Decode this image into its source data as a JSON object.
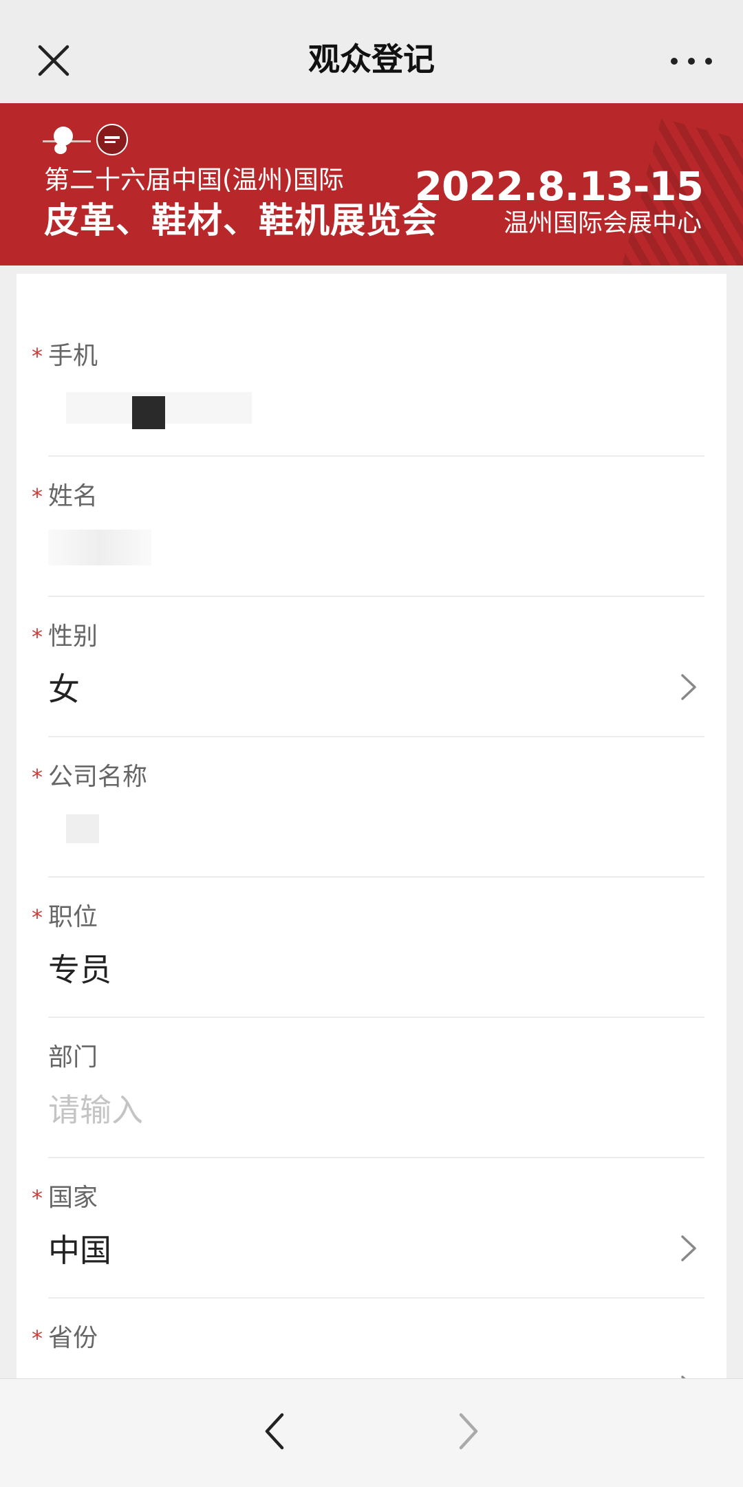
{
  "nav": {
    "title": "观众登记",
    "close_icon": "close-icon",
    "more_icon": "more-dots-icon"
  },
  "banner": {
    "line1": "第二十六届中国(温州)国际",
    "line2": "皮革、鞋材、鞋机展览会",
    "date": "2022.8.13-15",
    "venue": "温州国际会展中心",
    "accent_color": "#b8282a"
  },
  "form": {
    "required_mark": "*",
    "fields": [
      {
        "label": "手机",
        "required": true,
        "value": ""
      },
      {
        "label": "姓名",
        "required": true,
        "value": ""
      },
      {
        "label": "性别",
        "required": true,
        "value": "女",
        "has_chevron": true
      },
      {
        "label": "公司名称",
        "required": true,
        "value": ""
      },
      {
        "label": "职位",
        "required": true,
        "value": "专员"
      },
      {
        "label": "部门",
        "required": false,
        "placeholder": "请输入"
      },
      {
        "label": "国家",
        "required": true,
        "value": "中国",
        "has_chevron": true
      },
      {
        "label": "省份",
        "required": true,
        "value": "",
        "has_chevron": true
      }
    ]
  },
  "bottom_bar": {
    "back_icon": "chevron-left-icon",
    "forward_icon": "chevron-right-icon"
  }
}
